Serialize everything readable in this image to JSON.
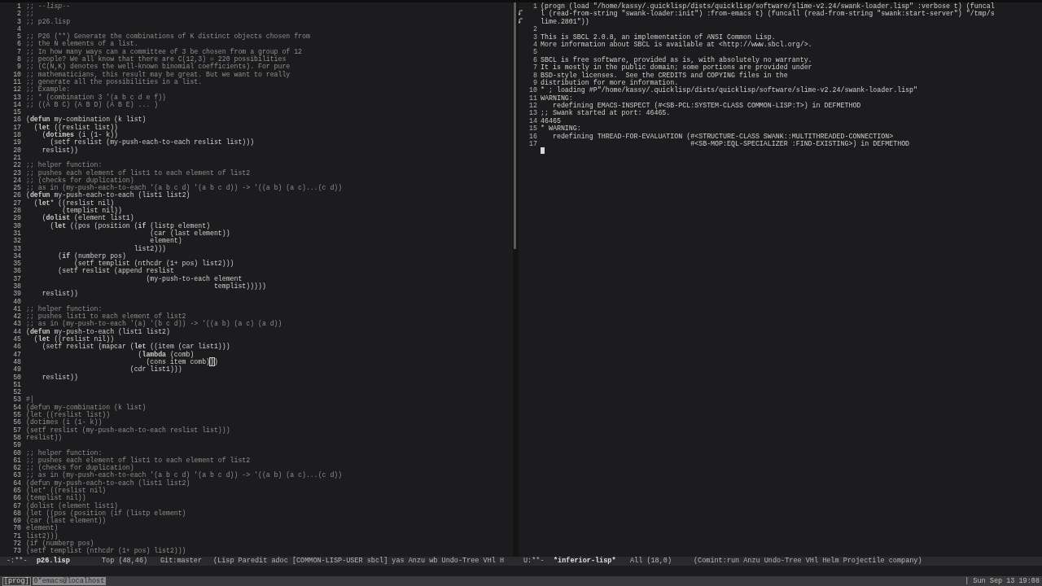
{
  "left_pane": {
    "lines": [
      {
        "n": "1",
        "text": ";; -*-lisp-*-",
        "kind": "comment"
      },
      {
        "n": "2",
        "text": ";;",
        "kind": "comment"
      },
      {
        "n": "3",
        "text": ";; p26.lisp",
        "kind": "comment"
      },
      {
        "n": "4"
      },
      {
        "n": "5",
        "text": ";; P26 (**) Generate the combinations of K distinct objects chosen from",
        "kind": "comment"
      },
      {
        "n": "6",
        "text": ";; the N elements of a list.",
        "kind": "comment"
      },
      {
        "n": "7",
        "text": ";; In how many ways can a committee of 3 be chosen from a group of 12",
        "kind": "comment"
      },
      {
        "n": "8",
        "text": ";; people? We all know that there are C(12,3) = 220 possibilities",
        "kind": "comment"
      },
      {
        "n": "9",
        "text": ";; (C(N,K) denotes the well-known binomial coefficients). For pure",
        "kind": "comment"
      },
      {
        "n": "10",
        "text": ";; mathematicians, this result may be great. But we want to really",
        "kind": "comment"
      },
      {
        "n": "11",
        "text": ";; generate all the possibilities in a list.",
        "kind": "comment"
      },
      {
        "n": "12",
        "text": ";; Example:",
        "kind": "comment"
      },
      {
        "n": "13",
        "text": ";; * (combination 3 '(a b c d e f))",
        "kind": "comment"
      },
      {
        "n": "14",
        "text": ";; ((A B C) (A B D) (A B E) ... )",
        "kind": "comment"
      },
      {
        "n": "15"
      },
      {
        "n": "16",
        "text": "(**defun** my-combination (k list)",
        "kind": "code"
      },
      {
        "n": "17",
        "text": "  (**let** ((reslist list))",
        "kind": "code"
      },
      {
        "n": "18",
        "text": "    (**dotimes** (i (1- k))",
        "kind": "code"
      },
      {
        "n": "19",
        "text": "      (setf reslist (my-push-each-to-each reslist list)))",
        "kind": "code"
      },
      {
        "n": "20",
        "text": "    reslist))",
        "kind": "code"
      },
      {
        "n": "21"
      },
      {
        "n": "22",
        "text": ";; helper function:",
        "kind": "comment"
      },
      {
        "n": "23",
        "text": ";; pushes each element of list1 to each element of list2",
        "kind": "comment"
      },
      {
        "n": "24",
        "text": ";; (checks for duplication)",
        "kind": "comment"
      },
      {
        "n": "25",
        "text": ";; as in (my-push-each-to-each '(a b c d) '(a b c d)) -> '((a b) (a c)...(c d))",
        "kind": "comment"
      },
      {
        "n": "26",
        "text": "(**defun** my-push-each-to-each (list1 list2)",
        "kind": "code"
      },
      {
        "n": "27",
        "text": "  (**let*** ((reslist nil)",
        "kind": "code"
      },
      {
        "n": "28",
        "text": "         (templist nil))",
        "kind": "code"
      },
      {
        "n": "29",
        "text": "    (**dolist** (element list1)",
        "kind": "code"
      },
      {
        "n": "30",
        "text": "      (**let** ((pos (position (**if** (listp element)",
        "kind": "code"
      },
      {
        "n": "31",
        "text": "                               (car (last element))",
        "kind": "code"
      },
      {
        "n": "32",
        "text": "                               element)",
        "kind": "code"
      },
      {
        "n": "33",
        "text": "                           list2)))",
        "kind": "code"
      },
      {
        "n": "34",
        "text": "        (**if** (numberp pos)",
        "kind": "code"
      },
      {
        "n": "35",
        "text": "            (setf templist (nthcdr (1+ pos) list2)))",
        "kind": "code"
      },
      {
        "n": "36",
        "text": "        (setf reslist (append reslist",
        "kind": "code"
      },
      {
        "n": "37",
        "text": "                              (my-push-to-each element",
        "kind": "code"
      },
      {
        "n": "38",
        "text": "                                               templist)))))",
        "kind": "code"
      },
      {
        "n": "39",
        "text": "    reslist))",
        "kind": "code"
      },
      {
        "n": "40"
      },
      {
        "n": "41",
        "text": ";; helper function:",
        "kind": "comment"
      },
      {
        "n": "42",
        "text": ";; pushes list1 to each element of list2",
        "kind": "comment"
      },
      {
        "n": "43",
        "text": ";; as in (my-push-to-each '(a) '(b c d)) -> '((a b) (a c) (a d))",
        "kind": "comment"
      },
      {
        "n": "44",
        "text": "(**defun** my-push-to-each (list1 list2)",
        "kind": "code"
      },
      {
        "n": "45",
        "text": "  (**let** ((reslist nil))",
        "kind": "code"
      },
      {
        "n": "46",
        "text": "    (setf reslist (mapcar (**let** ((item (car list1)))",
        "kind": "code"
      },
      {
        "n": "47",
        "text": "                            (**lambda** (comb)",
        "kind": "code"
      },
      {
        "n": "48",
        "text": "                              (cons item comb)",
        "cursor": ")",
        "after": ")",
        "kind": "code"
      },
      {
        "n": "49",
        "text": "                          (cdr list1)))",
        "kind": "code"
      },
      {
        "n": "50",
        "text": "    reslist))",
        "kind": "code"
      },
      {
        "n": "51"
      },
      {
        "n": "52"
      },
      {
        "n": "53",
        "text": "#|",
        "kind": "comment"
      },
      {
        "n": "54",
        "text": "(defun my-combination (k list)",
        "kind": "comment"
      },
      {
        "n": "55",
        "text": "(let ((reslist list))",
        "kind": "comment"
      },
      {
        "n": "56",
        "text": "(dotimes (i (1- k))",
        "kind": "comment"
      },
      {
        "n": "57",
        "text": "(setf reslist (my-push-each-to-each reslist list)))",
        "kind": "comment"
      },
      {
        "n": "58",
        "text": "reslist))",
        "kind": "comment"
      },
      {
        "n": "59"
      },
      {
        "n": "60",
        "text": ";; helper function:",
        "kind": "comment"
      },
      {
        "n": "61",
        "text": ";; pushes each element of list1 to each element of list2",
        "kind": "comment"
      },
      {
        "n": "62",
        "text": ";; (checks for duplication)",
        "kind": "comment"
      },
      {
        "n": "63",
        "text": ";; as in (my-push-each-to-each '(a b c d) '(a b c d)) -> '((a b) (a c)...(c d))",
        "kind": "comment"
      },
      {
        "n": "64",
        "text": "(defun my-push-each-to-each (list1 list2)",
        "kind": "comment"
      },
      {
        "n": "65",
        "text": "(let* ((reslist nil)",
        "kind": "comment"
      },
      {
        "n": "66",
        "text": "(templist nil))",
        "kind": "comment"
      },
      {
        "n": "67",
        "text": "(dolist (element list1)",
        "kind": "comment"
      },
      {
        "n": "68",
        "text": "(let ((pos (position (if (listp element)",
        "kind": "comment"
      },
      {
        "n": "69",
        "text": "(car (last element))",
        "kind": "comment"
      },
      {
        "n": "70",
        "text": "element)",
        "kind": "comment"
      },
      {
        "n": "71",
        "text": "list2)))",
        "kind": "comment"
      },
      {
        "n": "72",
        "text": "(if (numberp pos)",
        "kind": "comment"
      },
      {
        "n": "73",
        "text": "(setf templist (nthcdr (1+ pos) list2)))",
        "kind": "comment"
      }
    ],
    "mode_line": {
      "status": "-:**-",
      "buffer": "p26.lisp",
      "position": "Top (48,46)",
      "vc": "Git:master",
      "modes": "(Lisp Paredit adoc [COMMON-LISP-USER sbcl] yas Anzu wb Undo-Tree VHl H"
    }
  },
  "right_pane": {
    "lines": [
      {
        "n": "1",
        "parts": [
          "(progn (load \"/home/kassy/.quicklisp/dists/quicklisp/software/slime-v2.24/swank-loader.lisp\" :verbose t) (funcal",
          "l (read-from-string \"swank-loader:init\") :from-emacs t) (funcall (read-from-string \"swank:start-server\") \"/tmp/s",
          "lime.2801\"))"
        ]
      },
      {
        "n": "2"
      },
      {
        "n": "3",
        "parts": [
          "This is SBCL 2.0.8, an implementation of ANSI Common Lisp."
        ]
      },
      {
        "n": "4",
        "parts": [
          "More information about SBCL is available at <http://www.sbcl.org/>."
        ]
      },
      {
        "n": "5"
      },
      {
        "n": "6",
        "parts": [
          "SBCL is free software, provided as is, with absolutely no warranty."
        ]
      },
      {
        "n": "7",
        "parts": [
          "It is mostly in the public domain; some portions are provided under"
        ]
      },
      {
        "n": "8",
        "parts": [
          "BSD-style licenses.  See the CREDITS and COPYING files in the"
        ]
      },
      {
        "n": "9",
        "parts": [
          "distribution for more information."
        ]
      },
      {
        "n": "10",
        "parts": [
          "* ; loading #P\"/home/kassy/.quicklisp/dists/quicklisp/software/slime-v2.24/swank-loader.lisp\""
        ]
      },
      {
        "n": "11",
        "parts": [
          "WARNING:"
        ]
      },
      {
        "n": "12",
        "parts": [
          "   redefining EMACS-INSPECT (#<SB-PCL:SYSTEM-CLASS COMMON-LISP:T>) in DEFMETHOD"
        ]
      },
      {
        "n": "13",
        "parts": [
          ";; Swank started at port: 46465."
        ]
      },
      {
        "n": "14",
        "parts": [
          "46465"
        ]
      },
      {
        "n": "15",
        "parts": [
          "* WARNING:"
        ]
      },
      {
        "n": "16",
        "parts": [
          "   redefining THREAD-FOR-EVALUATION (#<STRUCTURE-CLASS SWANK::MULTITHREADED-CONNECTION>"
        ]
      },
      {
        "n": "17",
        "parts": [
          "                                     #<SB-MOP:EQL-SPECIALIZER :FIND-EXISTING>) in DEFMETHOD"
        ]
      },
      {
        "cursor": true
      }
    ],
    "mode_line": {
      "status": "U:**-",
      "buffer": "*inferior-lisp*",
      "position": "All (18,0)",
      "modes": "(Comint:run Anzu Undo-Tree VHl Helm Projectile company)"
    }
  },
  "bar": {
    "workspace": "[prog]",
    "window": "0*emacs@localhost",
    "clock": "| Sun Sep 13 19:08"
  }
}
